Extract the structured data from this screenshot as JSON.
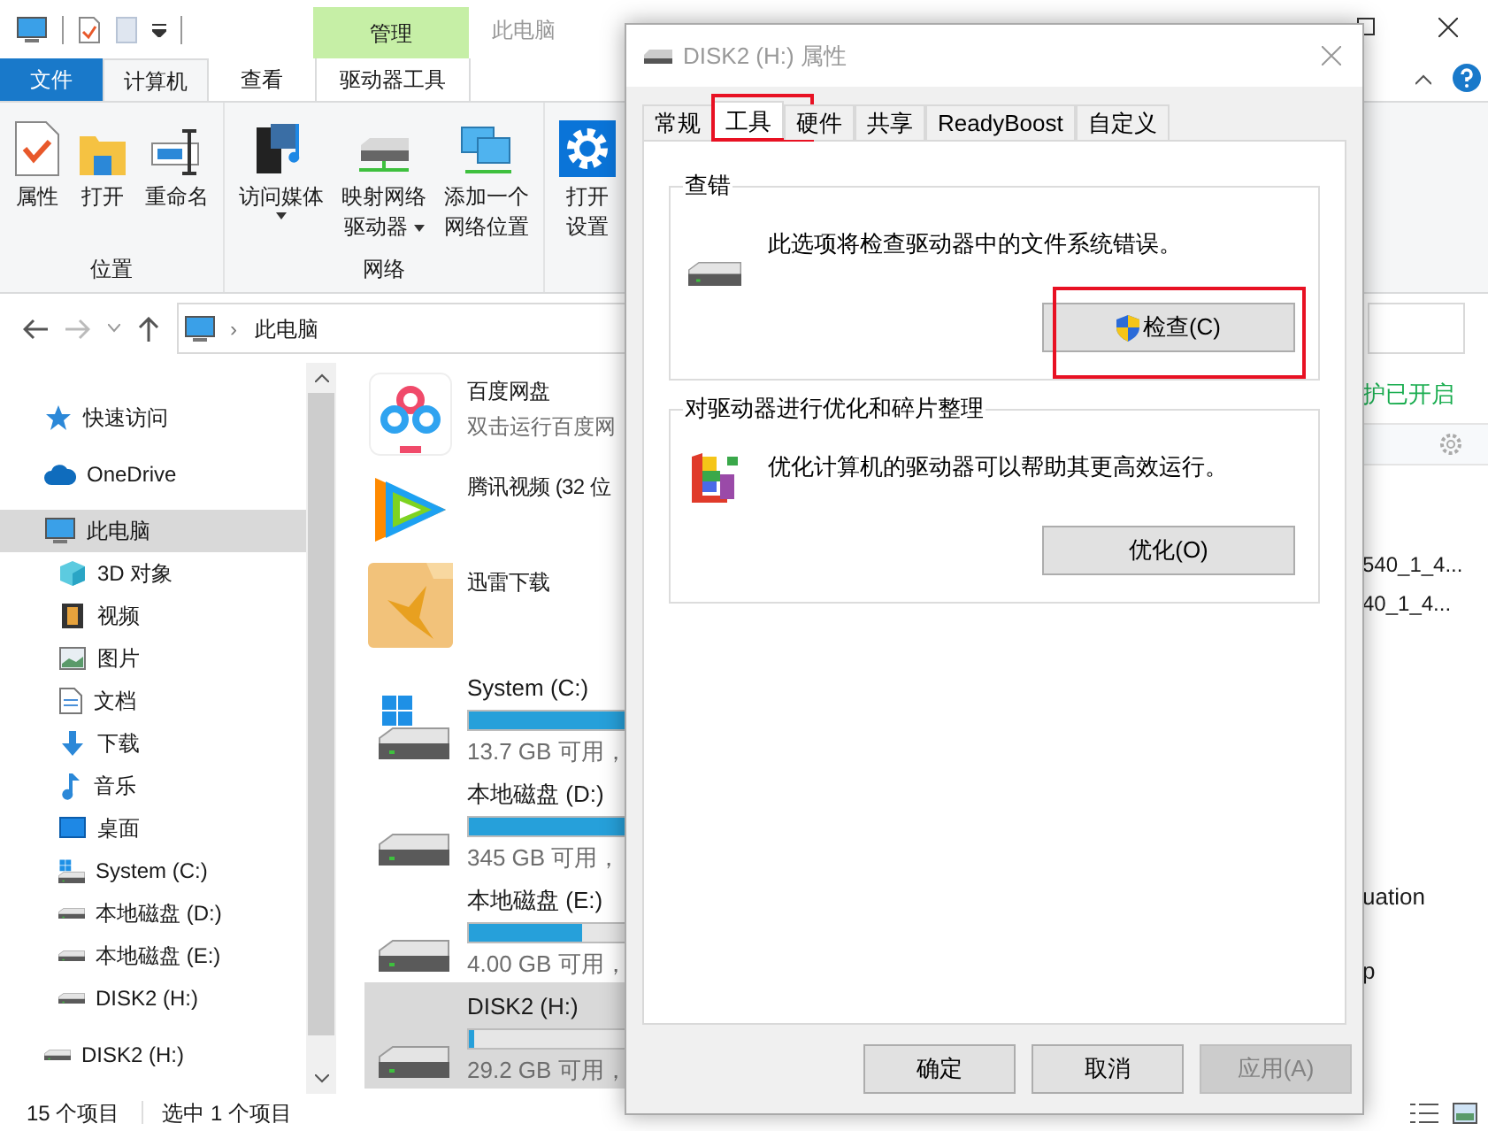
{
  "explorer": {
    "title": "此电脑",
    "context_group": "管理",
    "ribbon_tabs": [
      {
        "label": "文件",
        "kind": "file",
        "selected": false
      },
      {
        "label": "计算机",
        "kind": "tab",
        "selected": true
      },
      {
        "label": "查看",
        "kind": "tab",
        "selected": false
      },
      {
        "label": "驱动器工具",
        "kind": "context",
        "selected": false
      }
    ],
    "ribbon_groups": [
      {
        "label": "位置",
        "buttons": [
          {
            "kind": "properties",
            "lines": [
              "属性"
            ],
            "dropdown": false
          },
          {
            "kind": "folder",
            "lines": [
              "打开"
            ],
            "dropdown": false
          },
          {
            "kind": "rename",
            "lines": [
              "重命名"
            ],
            "dropdown": false
          }
        ]
      },
      {
        "label": "网络",
        "buttons": [
          {
            "kind": "media",
            "lines": [
              "访问媒体"
            ],
            "dropdown": true
          },
          {
            "kind": "netdrive",
            "lines": [
              "映射网络",
              "驱动器"
            ],
            "dropdown": true
          },
          {
            "kind": "netlocation",
            "lines": [
              "添加一个",
              "网络位置"
            ],
            "dropdown": false
          }
        ]
      },
      {
        "buttons": [
          {
            "kind": "settings",
            "lines": [
              "打开",
              "设置"
            ],
            "dropdown": false
          }
        ]
      }
    ],
    "address": {
      "separator": "›",
      "path": [
        "此电脑"
      ]
    },
    "nav": [
      {
        "label": "快速访问",
        "kind": "star",
        "selected": false
      },
      {
        "label": "OneDrive",
        "kind": "cloud",
        "selected": false
      },
      {
        "label": "此电脑",
        "kind": "pc",
        "selected": true,
        "children": [
          {
            "label": "3D 对象",
            "kind": "cube",
            "selected": false
          },
          {
            "label": "视频",
            "kind": "film",
            "selected": false
          },
          {
            "label": "图片",
            "kind": "image",
            "selected": false
          },
          {
            "label": "文档",
            "kind": "doc",
            "selected": false
          },
          {
            "label": "下载",
            "kind": "download",
            "selected": false
          },
          {
            "label": "音乐",
            "kind": "music",
            "selected": false
          },
          {
            "label": "桌面",
            "kind": "desktop",
            "selected": false
          },
          {
            "label": "System (C:)",
            "kind": "windrive",
            "selected": false
          },
          {
            "label": "本地磁盘 (D:)",
            "kind": "drive",
            "selected": false
          },
          {
            "label": "本地磁盘 (E:)",
            "kind": "drive",
            "selected": false
          },
          {
            "label": "DISK2 (H:)",
            "kind": "drive",
            "selected": false
          }
        ]
      },
      {
        "label": "DISK2 (H:)",
        "kind": "drive",
        "selected": false
      }
    ],
    "items": [
      {
        "kind": "baidu",
        "name": "百度网盘",
        "subtitle": "双击运行百度网",
        "selected": false
      },
      {
        "kind": "tencent",
        "name": "腾讯视频 (32 位",
        "selected": false
      },
      {
        "kind": "xunlei",
        "name": "迅雷下载",
        "selected": false
      },
      {
        "kind": "windrive",
        "name": "System (C:)",
        "level": 0.92,
        "free": "13.7 GB 可用，",
        "selected": false
      },
      {
        "kind": "drive",
        "name": "本地磁盘 (D:)",
        "level": 0.85,
        "free": "345 GB 可用，",
        "selected": false
      },
      {
        "kind": "drive",
        "name": "本地磁盘 (E:)",
        "level": 0.34,
        "free": "4.00 GB 可用，",
        "selected": false
      },
      {
        "kind": "drive",
        "name": "DISK2 (H:)",
        "level": 0.015,
        "free": "29.2 GB 可用，",
        "selected": true
      }
    ],
    "side_panel": {
      "status": "护已开启",
      "file_names": [
        "540_1_4...",
        "40_1_4..."
      ],
      "other_texts": [
        "uation",
        "p"
      ]
    },
    "status_bar": {
      "count": "15 个项目",
      "selection": "选中 1 个项目"
    }
  },
  "dialog": {
    "title": "DISK2 (H:) 属性",
    "tabs": [
      {
        "label": "常规",
        "selected": false,
        "highlighted": false
      },
      {
        "label": "工具",
        "selected": true,
        "highlighted": true
      },
      {
        "label": "硬件",
        "selected": false,
        "highlighted": false
      },
      {
        "label": "共享",
        "selected": false,
        "highlighted": false
      },
      {
        "label": "ReadyBoost",
        "selected": false,
        "highlighted": false
      },
      {
        "label": "自定义",
        "selected": false,
        "highlighted": false
      }
    ],
    "sections": [
      {
        "title": "查错",
        "kind": "drive",
        "text": "此选项将检查驱动器中的文件系统错误。",
        "button": "检查(C)",
        "shield": true,
        "highlighted": true
      },
      {
        "title": "对驱动器进行优化和碎片整理",
        "kind": "defrag",
        "text": "优化计算机的驱动器可以帮助其更高效运行。",
        "button": "优化(O)",
        "shield": false,
        "highlighted": false
      }
    ],
    "buttons": [
      {
        "label": "确定",
        "disabled": false
      },
      {
        "label": "取消",
        "disabled": false
      },
      {
        "label": "应用(A)",
        "disabled": true
      }
    ]
  }
}
